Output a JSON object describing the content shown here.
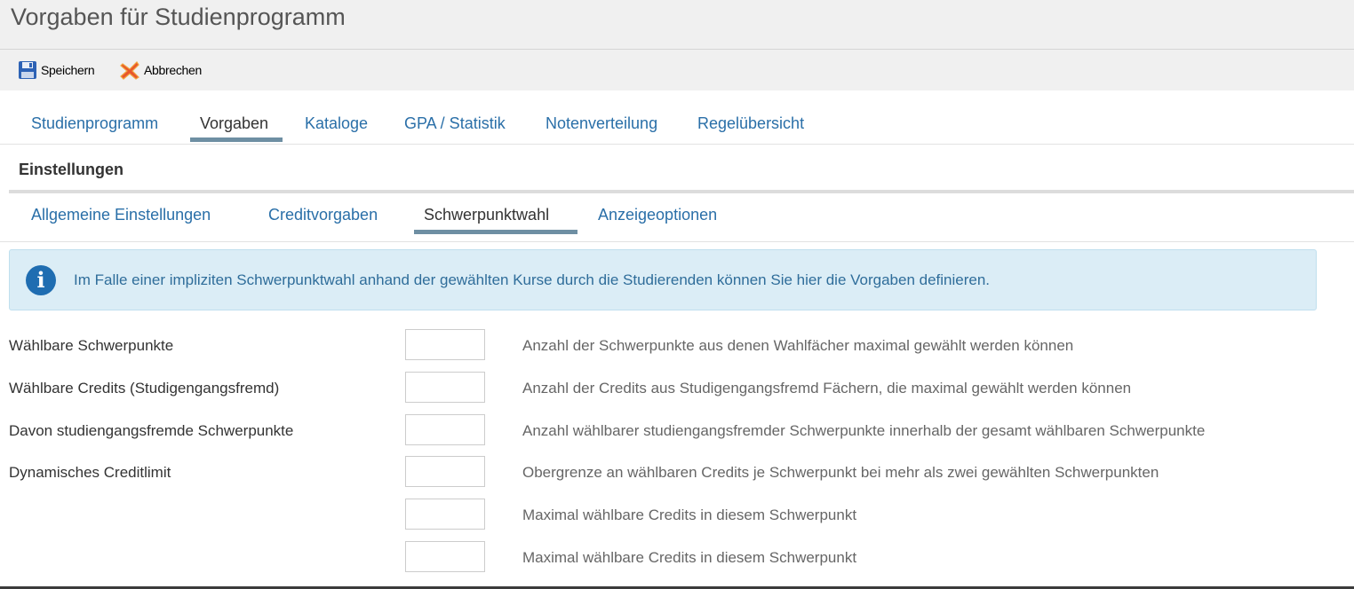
{
  "header": {
    "title": "Vorgaben für Studienprogramm"
  },
  "toolbar": {
    "save_label": "Speichern",
    "cancel_label": "Abbrechen",
    "save_icon": "floppy-disk-icon",
    "cancel_icon": "red-x-icon"
  },
  "main_tabs": [
    {
      "label": "Studienprogramm",
      "active": false
    },
    {
      "label": "Vorgaben",
      "active": true
    },
    {
      "label": "Kataloge",
      "active": false
    },
    {
      "label": "GPA / Statistik",
      "active": false
    },
    {
      "label": "Notenverteilung",
      "active": false
    },
    {
      "label": "Regelübersicht",
      "active": false
    }
  ],
  "section": {
    "title": "Einstellungen"
  },
  "sub_tabs": [
    {
      "label": "Allgemeine Einstellungen",
      "active": false
    },
    {
      "label": "Creditvorgaben",
      "active": false
    },
    {
      "label": "Schwerpunktwahl",
      "active": true
    },
    {
      "label": "Anzeigeoptionen",
      "active": false
    }
  ],
  "info": {
    "icon": "info-circle-icon",
    "text": "Im Falle einer impliziten Schwerpunktwahl anhand der gewählten Kurse durch die Studierenden können Sie hier die Vorgaben definieren."
  },
  "form": {
    "rows": [
      {
        "label": "Wählbare Schwerpunkte",
        "value": "",
        "description": "Anzahl der Schwerpunkte aus denen Wahlfächer maximal gewählt werden können"
      },
      {
        "label": "Wählbare Credits (Studigengangsfremd)",
        "value": "",
        "description": "Anzahl der Credits aus Studigengangsfremd Fächern, die maximal gewählt werden können"
      },
      {
        "label": "Davon studiengangsfremde Schwerpunkte",
        "value": "",
        "description": "Anzahl wählbarer studiengangsfremder Schwerpunkte innerhalb der gesamt wählbaren Schwerpunkte"
      },
      {
        "label": "Dynamisches Creditlimit",
        "value": "",
        "description": "Obergrenze an wählbaren Credits je Schwerpunkt bei mehr als zwei gewählten Schwerpunkten"
      },
      {
        "label": "",
        "value": "",
        "description": "Maximal wählbare Credits in diesem Schwerpunkt"
      },
      {
        "label": "",
        "value": "",
        "description": "Maximal wählbare Credits in diesem Schwerpunkt"
      }
    ]
  },
  "colors": {
    "link": "#2a6fa8",
    "active_tab_underline": "#6e8fa3",
    "info_background": "#dbedf6",
    "info_icon": "#1f6db1"
  }
}
